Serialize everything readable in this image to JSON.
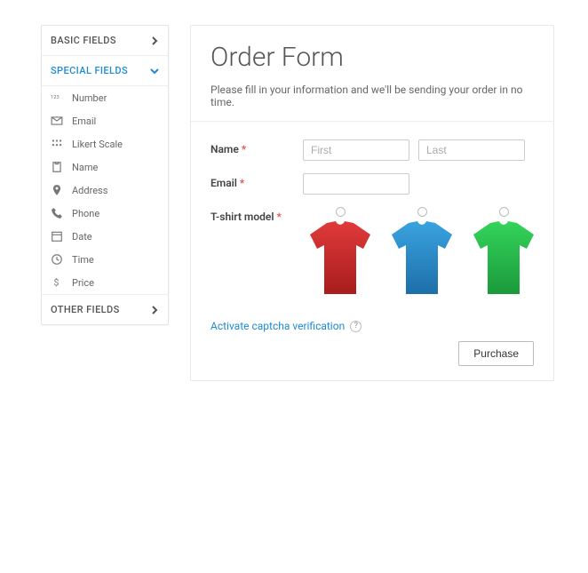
{
  "sidebar": {
    "groups": {
      "basic": {
        "label": "BASIC FIELDS"
      },
      "special": {
        "label": "SPECIAL FIELDS"
      },
      "other": {
        "label": "OTHER FIELDS"
      }
    },
    "specialItems": [
      {
        "label": "Number"
      },
      {
        "label": "Email"
      },
      {
        "label": "Likert Scale"
      },
      {
        "label": "Name"
      },
      {
        "label": "Address"
      },
      {
        "label": "Phone"
      },
      {
        "label": "Date"
      },
      {
        "label": "Time"
      },
      {
        "label": "Price"
      }
    ]
  },
  "form": {
    "title": "Order Form",
    "description": "Please fill in your information and we'll be sending your order in no time.",
    "labels": {
      "name": "Name",
      "email": "Email",
      "tshirt": "T-shirt model"
    },
    "placeholders": {
      "first": "First",
      "last": "Last"
    },
    "tshirtColors": {
      "a": "#d62828",
      "b": "#2a8fd6",
      "c": "#22c24a"
    },
    "captcha": "Activate captcha verification",
    "helpMark": "?",
    "submit": "Purchase",
    "requiredMark": "*"
  }
}
